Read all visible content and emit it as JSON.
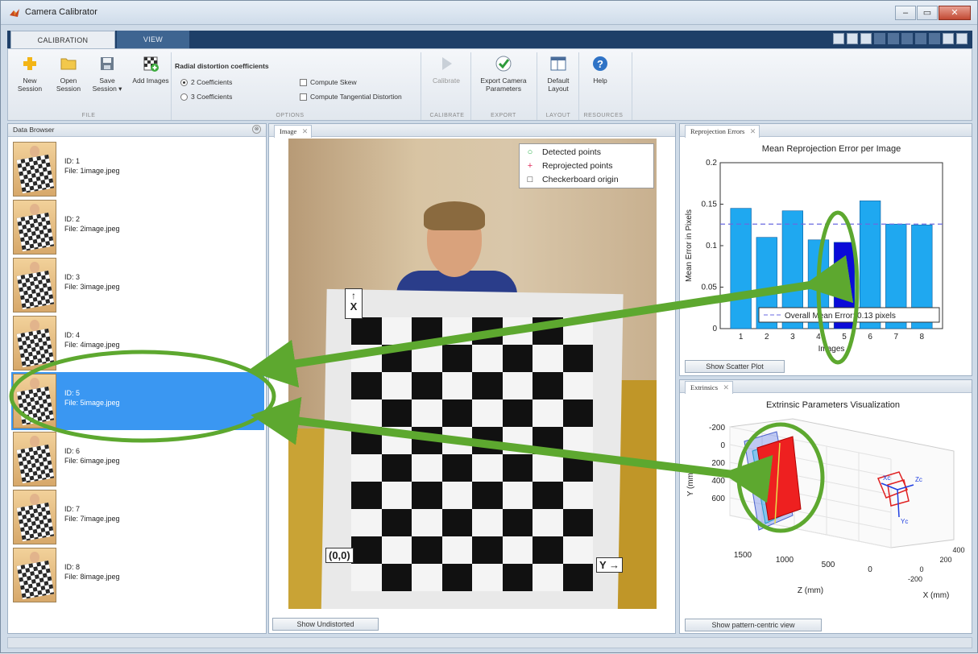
{
  "window": {
    "title": "Camera Calibrator",
    "controls": [
      "–",
      "▭",
      "✕"
    ]
  },
  "ribbon": {
    "tabs": [
      {
        "label": "CALIBRATION",
        "active": true
      },
      {
        "label": "VIEW",
        "active": false
      }
    ],
    "file": {
      "new_session": "New Session",
      "open_session": "Open Session",
      "save_session": "Save Session ▾",
      "add_images": "Add Images",
      "group": "FILE"
    },
    "options": {
      "title": "Radial distortion coefficients",
      "radio_2": "2 Coefficients",
      "radio_3": "3 Coefficients",
      "compute_skew": "Compute Skew",
      "compute_tangential": "Compute Tangential Distortion",
      "group": "OPTIONS"
    },
    "calibrate": {
      "label": "Calibrate",
      "group": "CALIBRATE"
    },
    "export": {
      "label": "Export Camera Parameters",
      "group": "EXPORT"
    },
    "layout": {
      "label": "Default Layout",
      "group": "LAYOUT"
    },
    "help": {
      "label": "Help",
      "group": "RESOURCES"
    }
  },
  "data_browser": {
    "title": "Data Browser",
    "items": [
      {
        "id": "ID: 1",
        "file": "File: 1image.jpeg"
      },
      {
        "id": "ID: 2",
        "file": "File: 2image.jpeg"
      },
      {
        "id": "ID: 3",
        "file": "File: 3image.jpeg"
      },
      {
        "id": "ID: 4",
        "file": "File: 4image.jpeg"
      },
      {
        "id": "ID: 5",
        "file": "File: 5image.jpeg",
        "selected": true
      },
      {
        "id": "ID: 6",
        "file": "File: 6image.jpeg"
      },
      {
        "id": "ID: 7",
        "file": "File: 7image.jpeg"
      },
      {
        "id": "ID: 8",
        "file": "File: 8image.jpeg"
      }
    ]
  },
  "image_panel": {
    "tab": "Image",
    "legend": [
      "Detected points",
      "Reprojected points",
      "Checkerboard origin"
    ],
    "label_x": "X",
    "label_y": "Y",
    "label_origin": "(0,0)",
    "button": "Show Undistorted"
  },
  "reprojection_panel": {
    "tab": "Reprojection Errors",
    "button": "Show Scatter Plot"
  },
  "extrinsics_panel": {
    "tab": "Extrinsics",
    "button": "Show pattern-centric view"
  },
  "chart_data": [
    {
      "type": "bar",
      "title": "Mean Reprojection Error per Image",
      "xlabel": "Images",
      "ylabel": "Mean Error in Pixels",
      "categories": [
        "1",
        "2",
        "3",
        "4",
        "5",
        "6",
        "7",
        "8"
      ],
      "values": [
        0.145,
        0.11,
        0.142,
        0.107,
        0.104,
        0.154,
        0.126,
        0.125
      ],
      "highlight_index": 4,
      "ylim": [
        0,
        0.2
      ],
      "yticks": [
        "0",
        "0.05",
        "0.1",
        "0.15",
        "0.2"
      ],
      "overall_mean": 0.126,
      "legend": "Overall Mean Error: 0.13 pixels",
      "colors": {
        "bar": "#1fa8f0",
        "highlight": "#0b0bd8",
        "mean_line": "#6a6ae0"
      }
    },
    {
      "type": "scatter",
      "title": "Extrinsic Parameters Visualization",
      "ylabel": "Y (mm)",
      "zlabel": "Z (mm)",
      "xlabel": "X (mm)",
      "yticks": [
        "-200",
        "0",
        "200",
        "400",
        "600"
      ],
      "zticks": [
        "1500",
        "1000",
        "500",
        "0"
      ],
      "xticks": [
        "-200",
        "0",
        "200",
        "400"
      ],
      "camera_labels": [
        "Zc",
        "Xc",
        "Yc"
      ]
    }
  ]
}
